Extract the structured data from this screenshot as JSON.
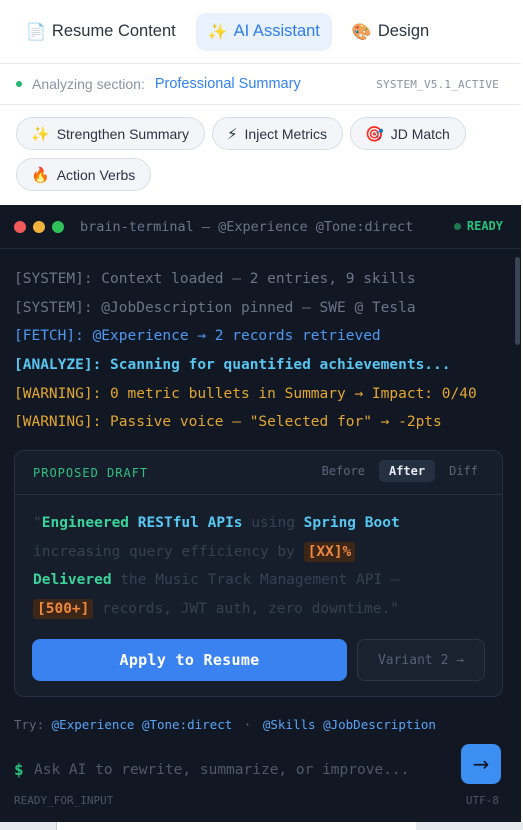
{
  "tabs": [
    {
      "label": "Resume Content",
      "icon": "document-icon",
      "emoji": "📄",
      "active": false
    },
    {
      "label": "AI Assistant",
      "icon": "sparkles-icon",
      "emoji": "✨",
      "active": true
    },
    {
      "label": "Design",
      "icon": "palette-icon",
      "emoji": "🎨",
      "active": false
    }
  ],
  "analyzing": {
    "label": "Analyzing section:",
    "section": "Professional Summary",
    "system_tag": "SYSTEM_V5.1_ACTIVE"
  },
  "chips": [
    {
      "label": "Strengthen Summary",
      "icon": "sparkles-icon",
      "emoji": "✨"
    },
    {
      "label": "Inject Metrics",
      "icon": "lightning-icon",
      "emoji": "⚡"
    },
    {
      "label": "JD Match",
      "icon": "target-icon",
      "emoji": "🎯"
    },
    {
      "label": "Action Verbs",
      "icon": "fire-icon",
      "emoji": "🔥"
    }
  ],
  "terminal": {
    "title": "brain-terminal — @Experience @Tone:direct",
    "status": "READY",
    "logs": [
      {
        "type": "system",
        "text": "[SYSTEM]: Context loaded — 2 entries, 9 skills"
      },
      {
        "type": "system",
        "text": "[SYSTEM]: @JobDescription pinned — SWE @ Tesla"
      },
      {
        "type": "fetch",
        "text": "[FETCH]: @Experience → 2 records retrieved"
      },
      {
        "type": "analyze",
        "text": "[ANALYZE]: Scanning for quantified achievements..."
      },
      {
        "type": "warn",
        "text": "[WARNING]: 0 metric bullets in Summary → Impact: 0/40"
      },
      {
        "type": "warn",
        "text": "[WARNING]: Passive voice — \"Selected for\" → -2pts"
      }
    ],
    "draft": {
      "title": "PROPOSED DRAFT",
      "views": [
        "Before",
        "After",
        "Diff"
      ],
      "active_view": "After",
      "line1_quote": "\"",
      "line1_a": "Engineered",
      "line1_b": "RESTful APIs",
      "line1_c": " using ",
      "line1_d": "Spring Boot",
      "line2_a": "increasing query efficiency by ",
      "line2_ph": "[XX]%",
      "line3_a": "Delivered",
      "line3_b": " the Music Track Management API —",
      "line4_ph": "[500+]",
      "line4_b": " records, JWT auth, zero downtime.\"",
      "apply_label": "Apply to Resume",
      "variant_label": "Variant 2 →"
    },
    "try": {
      "label": "Try:",
      "group1": "@Experience @Tone:direct",
      "separator": "·",
      "group2": "@Skills @JobDescription"
    },
    "input": {
      "prompt": "$",
      "placeholder": "Ask AI to rewrite, summarize, or improve...",
      "value": "",
      "send_icon": "→"
    },
    "footer": {
      "left": "READY_FOR_INPUT",
      "right": "UTF-8"
    }
  },
  "colors": {
    "accent": "#3a82f0",
    "terminal_bg": "#111824",
    "success": "#27c07a",
    "warning": "#e3a630",
    "placeholder_tag": "#f0883e"
  }
}
